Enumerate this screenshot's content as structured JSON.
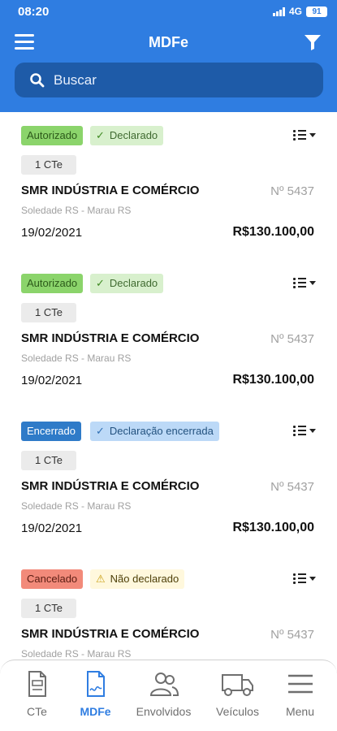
{
  "status_bar": {
    "time": "08:20",
    "network": "4G",
    "battery": "91"
  },
  "app_bar": {
    "title": "MDFe",
    "menu_icon": "hamburger-menu-icon",
    "filter_icon": "filter-funnel-icon"
  },
  "search": {
    "placeholder": "Buscar",
    "icon": "search-icon"
  },
  "cards": [
    {
      "status": "Autorizado",
      "declaration": "Declarado",
      "cte_count": "1 CTe",
      "company": "SMR INDÚSTRIA E COMÉRCIO",
      "number": "Nº 5437",
      "route": "Soledade RS - Marau RS",
      "date": "19/02/2021",
      "value": "R$130.100,00"
    },
    {
      "status": "Autorizado",
      "declaration": "Declarado",
      "cte_count": "1 CTe",
      "company": "SMR INDÚSTRIA E COMÉRCIO",
      "number": "Nº 5437",
      "route": "Soledade RS - Marau RS",
      "date": "19/02/2021",
      "value": "R$130.100,00"
    },
    {
      "status": "Encerrado",
      "declaration": "Declaração encerrada",
      "cte_count": "1 CTe",
      "company": "SMR INDÚSTRIA E COMÉRCIO",
      "number": "Nº 5437",
      "route": "Soledade RS - Marau RS",
      "date": "19/02/2021",
      "value": "R$130.100,00"
    },
    {
      "status": "Cancelado",
      "declaration": "Não declarado",
      "cte_count": "1 CTe",
      "company": "SMR INDÚSTRIA E COMÉRCIO",
      "number": "Nº 5437",
      "route": "Soledade RS - Marau RS",
      "date": "",
      "value": ""
    }
  ],
  "bottom_nav": [
    {
      "label": "CTe",
      "icon": "document-icon",
      "active": false
    },
    {
      "label": "MDFe",
      "icon": "document-signature-icon",
      "active": true
    },
    {
      "label": "Envolvidos",
      "icon": "people-icon",
      "active": false
    },
    {
      "label": "Veículos",
      "icon": "truck-icon",
      "active": false
    },
    {
      "label": "Menu",
      "icon": "hamburger-menu-icon",
      "active": false
    }
  ],
  "colors": {
    "primary": "#2f7de1",
    "search_bg": "#1e5ba8",
    "autorizado": "#8bd46b",
    "encerrado": "#2f7bc8",
    "cancelado": "#f28a7a",
    "muted_text": "#a0a0a0"
  }
}
